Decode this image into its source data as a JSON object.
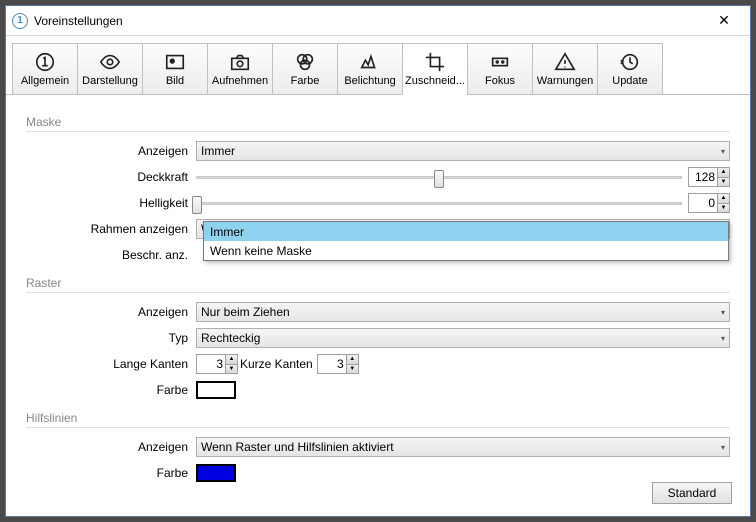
{
  "window": {
    "title": "Voreinstellungen"
  },
  "tabs": {
    "allgemein": "Allgemein",
    "darstellung": "Darstellung",
    "bild": "Bild",
    "aufnehmen": "Aufnehmen",
    "farbe": "Farbe",
    "belichtung": "Belichtung",
    "zuschneiden": "Zuschneid...",
    "fokus": "Fokus",
    "warnungen": "Warnungen",
    "update": "Update"
  },
  "sections": {
    "maske": "Maske",
    "raster": "Raster",
    "hilfslinien": "Hilfslinien"
  },
  "labels": {
    "anzeigen": "Anzeigen",
    "deckkraft": "Deckkraft",
    "helligkeit": "Helligkeit",
    "rahmen_anzeigen": "Rahmen anzeigen",
    "beschr_anz": "Beschr. anz.",
    "typ": "Typ",
    "lange_kanten": "Lange Kanten",
    "kurze_kanten": "Kurze Kanten",
    "farbe": "Farbe"
  },
  "values": {
    "maske_anzeigen": "Immer",
    "deckkraft": "128",
    "helligkeit": "0",
    "rahmen_anzeigen": "Wenn keine Maske",
    "raster_anzeigen": "Nur beim Ziehen",
    "typ": "Rechteckig",
    "lange_kanten": "3",
    "kurze_kanten": "3",
    "raster_farbe": "#ffffff",
    "hilfslinien_anzeigen": "Wenn Raster und Hilfslinien aktiviert",
    "hilfslinien_farbe": "#0000e0"
  },
  "dropdown": {
    "opt1": "Immer",
    "opt2": "Wenn keine Maske"
  },
  "buttons": {
    "standard": "Standard"
  }
}
